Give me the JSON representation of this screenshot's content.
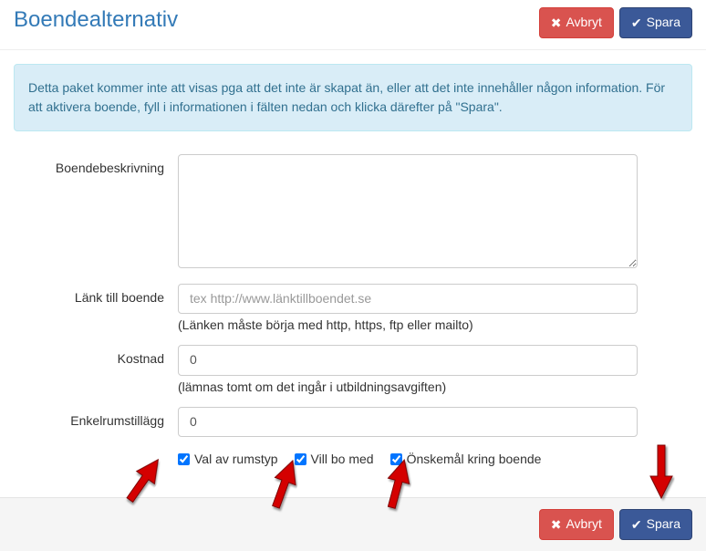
{
  "header": {
    "title": "Boendealternativ",
    "cancel_label": "Avbryt",
    "save_label": "Spara"
  },
  "alert": {
    "text": "Detta paket kommer inte att visas pga att det inte är skapat än, eller att det inte innehåller någon information. För att aktivera boende, fyll i informationen i fälten nedan och klicka därefter på \"Spara\"."
  },
  "form": {
    "description_label": "Boendebeskrivning",
    "description_value": "",
    "link_label": "Länk till boende",
    "link_placeholder": "tex http://www.länktillboendet.se",
    "link_value": "",
    "link_help": "(Länken måste börja med http, https, ftp eller mailto)",
    "cost_label": "Kostnad",
    "cost_value": "0",
    "cost_help": "(lämnas tomt om det ingår i utbildningsavgiften)",
    "singleroom_label": "Enkelrumstillägg",
    "singleroom_value": "0",
    "checkboxes": {
      "roomtype_label": "Val av rumstyp",
      "livewith_label": "Vill bo med",
      "wishes_label": "Önskemål kring boende"
    }
  },
  "footer": {
    "cancel_label": "Avbryt",
    "save_label": "Spara"
  },
  "colors": {
    "primary": "#337ab7",
    "danger": "#d9534f",
    "info_bg": "#d9edf7",
    "btn_primary": "#3b5998"
  }
}
